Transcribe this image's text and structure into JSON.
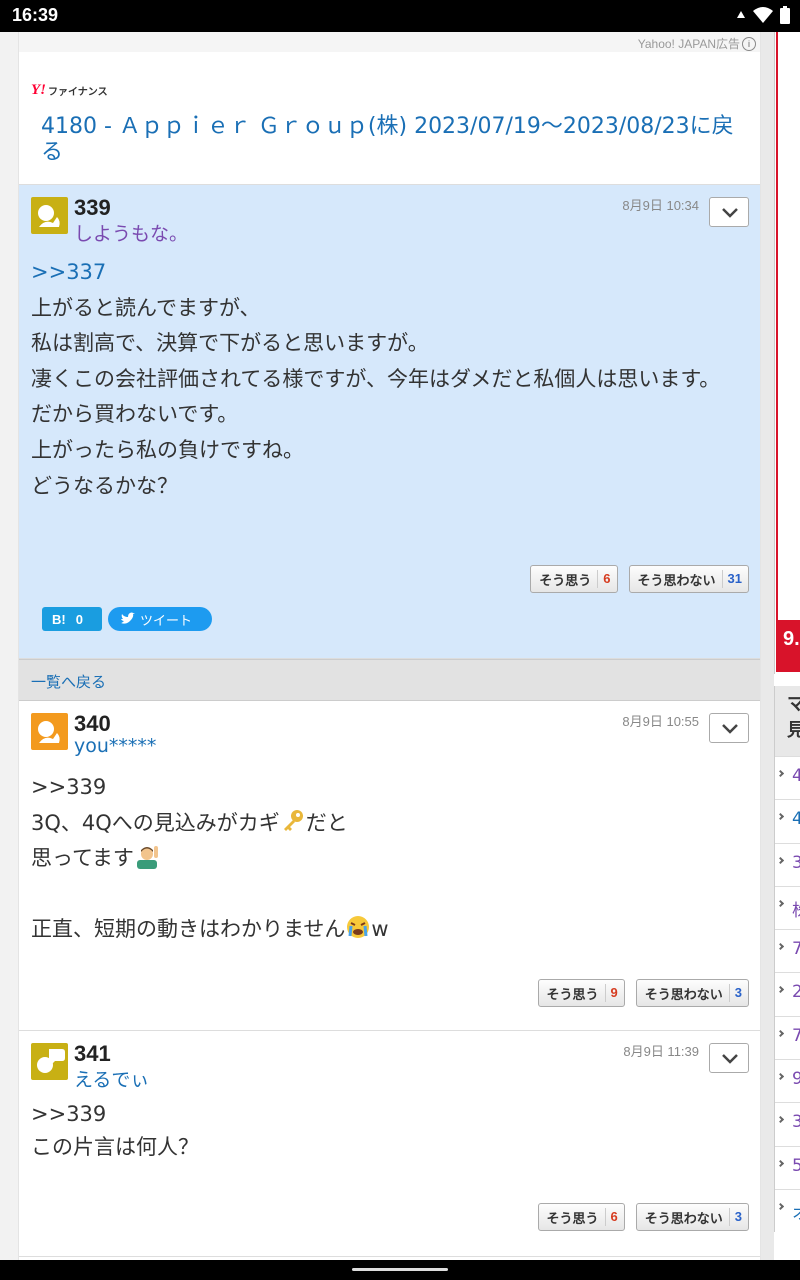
{
  "status_bar": {
    "time": "16:39"
  },
  "ad": {
    "label": "Yahoo! JAPAN広告"
  },
  "header": {
    "logo_text": "ファイナンス",
    "back_title": "4180 - Ａｐｐｉｅｒ Ｇｒｏｕｐ(株) 2023/07/19〜2023/08/23に戻る"
  },
  "comments": [
    {
      "num": "339",
      "user": "しようもな。",
      "date": "8月9日 10:34",
      "reply": ">>337",
      "body": "上がると読んでますが、\n私は割高で、決算で下がると思いますが。\n凄くこの会社評価されてる様ですが、今年はダメだと私個人は思います。\nだから買わないです。\n上がったら私の負けですね。\nどうなるかな？",
      "agree_label": "そう思う",
      "agree_count": "6",
      "disagree_label": "そう思わない",
      "disagree_count": "31",
      "hatena_count": "0",
      "tweet_label": "ツイート"
    },
    {
      "num": "340",
      "user": "you*****",
      "date": "8月9日 10:55",
      "line1": ">>339",
      "line2a": "3Q、4Qへの見込みがカギ",
      "line2b": "だと",
      "line3": "思ってます",
      "line5a": "正直、短期の動きはわかりません",
      "line5b": "w",
      "agree_label": "そう思う",
      "agree_count": "9",
      "disagree_label": "そう思わない",
      "disagree_count": "3"
    },
    {
      "num": "341",
      "user": "えるでぃ",
      "date": "8月9日 11:39",
      "body": ">>339\nこの片言は何人？",
      "agree_label": "そう思う",
      "agree_count": "6",
      "disagree_label": "そう思わない",
      "disagree_count": "3"
    }
  ],
  "back_list": "一覧へ戻る",
  "right_panel": {
    "ad_text": "9.",
    "list_head": "マ\n見",
    "items": [
      "4",
      "4",
      "3",
      "株",
      "7",
      "2",
      "7",
      "9",
      "3",
      "5",
      "オ"
    ]
  },
  "colors": {
    "link": "#1a6fb5",
    "highlight": "#d6e8fb",
    "agree": "#d63b1f",
    "disagree": "#2a62c9"
  }
}
